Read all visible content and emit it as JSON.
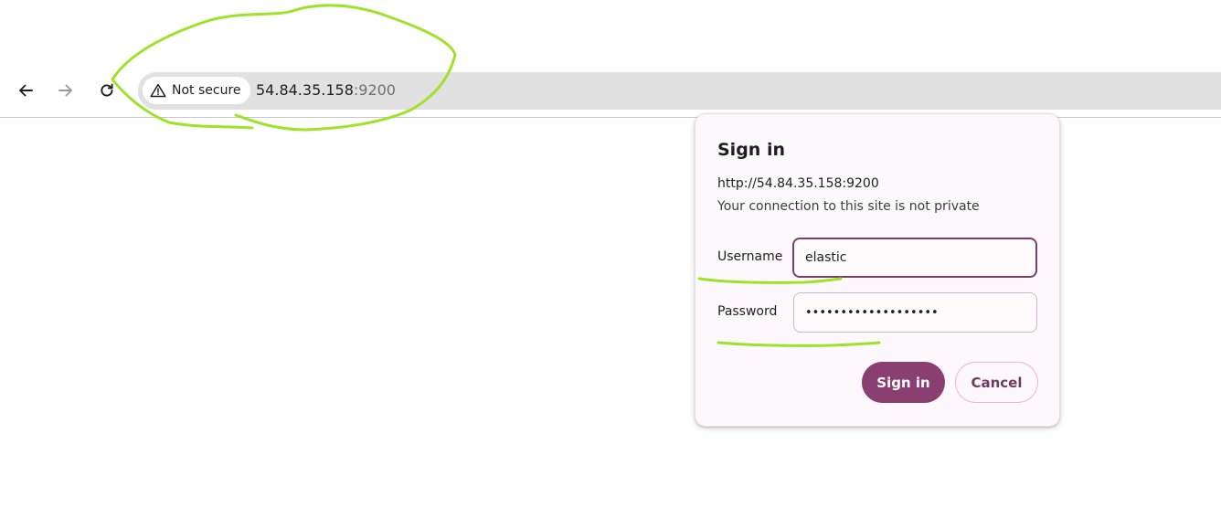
{
  "toolbar": {
    "back_icon": "arrow-left-icon",
    "forward_icon": "arrow-right-icon",
    "reload_icon": "reload-icon",
    "security_chip": {
      "icon": "warning-triangle-icon",
      "label": "Not secure"
    },
    "url": {
      "host": "54.84.35.158",
      "port": ":9200"
    }
  },
  "dialog": {
    "title": "Sign in",
    "origin": "http://54.84.35.158:9200",
    "note": "Your connection to this site is not private",
    "username": {
      "label": "Username",
      "value": "elastic"
    },
    "password": {
      "label": "Password",
      "value": "•••••••••••••••••••"
    },
    "sign_in_label": "Sign in",
    "cancel_label": "Cancel"
  },
  "annotation": {
    "color": "#9ee22a"
  }
}
